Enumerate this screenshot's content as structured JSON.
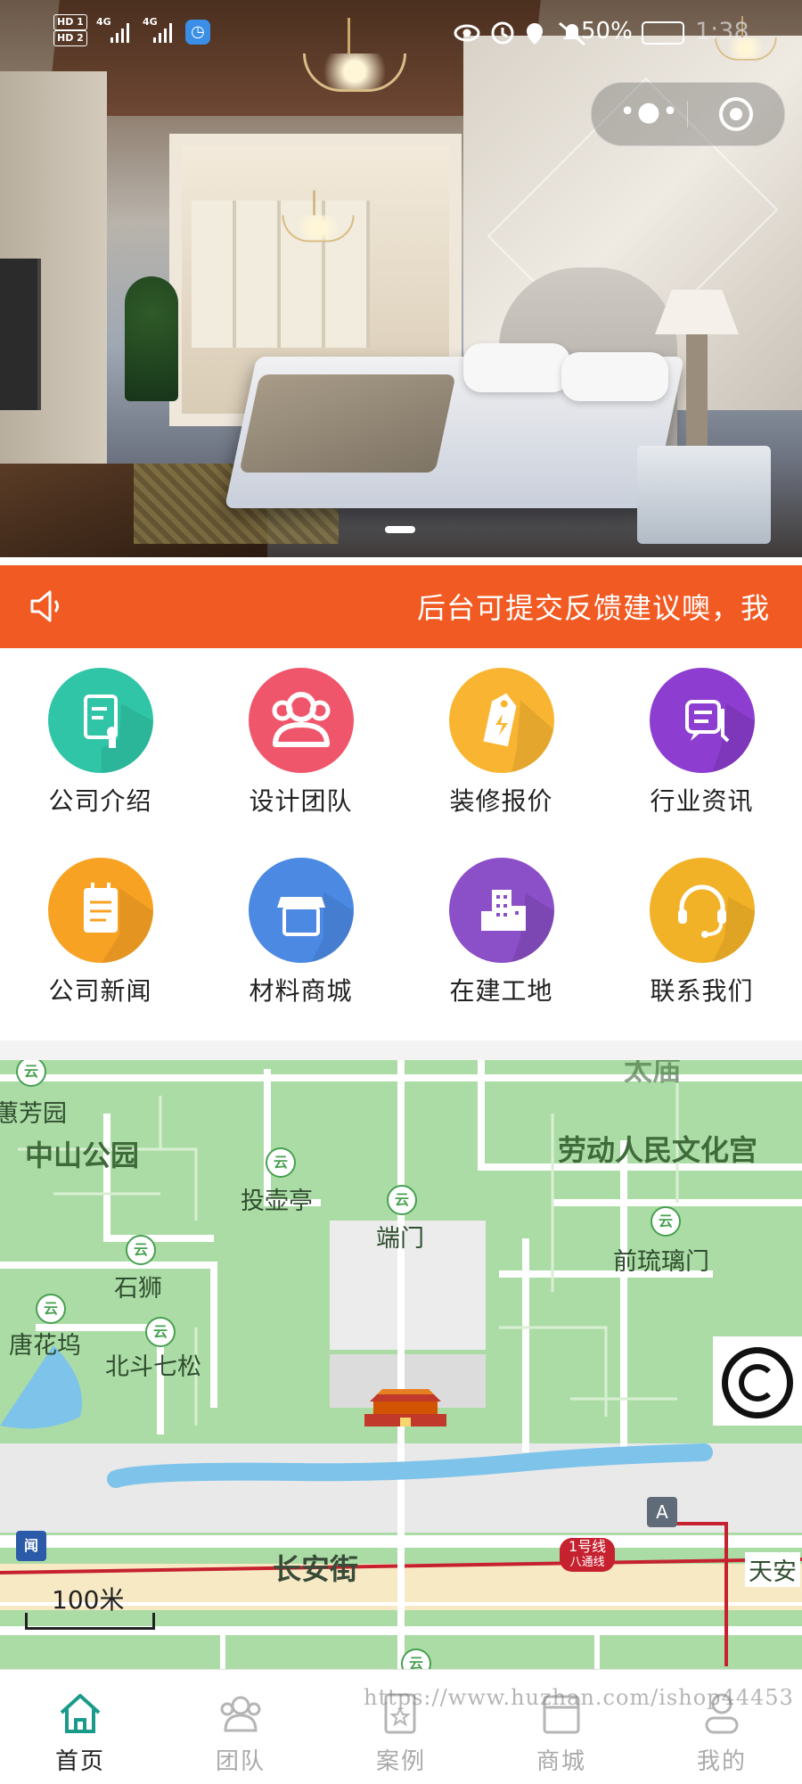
{
  "status_bar": {
    "sim1": "HD 1",
    "sim2": "HD 2",
    "net1": "4G",
    "net2": "4G",
    "battery": "50%",
    "time": "1:38"
  },
  "notice": {
    "text": "后台可提交反馈建议噢，我",
    "icon": "speaker-icon",
    "bg": "#f15a22"
  },
  "menu": [
    {
      "label": "公司介绍",
      "icon": "document-icon",
      "color": "#2fc5a6"
    },
    {
      "label": "设计团队",
      "icon": "team-icon",
      "color": "#f0566b"
    },
    {
      "label": "装修报价",
      "icon": "price-tag-icon",
      "color": "#f9b531"
    },
    {
      "label": "行业资讯",
      "icon": "chat-icon",
      "color": "#8d3ed0"
    },
    {
      "label": "公司新闻",
      "icon": "notepad-icon",
      "color": "#f8a224"
    },
    {
      "label": "材料商城",
      "icon": "shop-icon",
      "color": "#4b89e2"
    },
    {
      "label": "在建工地",
      "icon": "building-icon",
      "color": "#8b4fc8"
    },
    {
      "label": "联系我们",
      "icon": "headset-icon",
      "color": "#f2b227"
    }
  ],
  "map": {
    "labels": {
      "huifang": "蕙芳园",
      "zhongshan": "中山公园",
      "touhu": "投壶亭",
      "duanmen": "端门",
      "laodong": "劳动人民文化宫",
      "qianliuli": "前琉璃门",
      "shishi": "石狮",
      "tanghuawu": "唐花坞",
      "beidou": "北斗七松",
      "changan": "长安街",
      "tianan": "天安",
      "taimiao": "太庙"
    },
    "metro_line1": "1号线",
    "metro_line8": "八通线",
    "line_a": "A",
    "scale": "100米"
  },
  "tabs": [
    {
      "label": "首页",
      "icon": "home-icon",
      "active": true
    },
    {
      "label": "团队",
      "icon": "team-icon",
      "active": false
    },
    {
      "label": "案例",
      "icon": "case-icon",
      "active": false
    },
    {
      "label": "商城",
      "icon": "shop-icon",
      "active": false
    },
    {
      "label": "我的",
      "icon": "user-icon",
      "active": false
    }
  ],
  "watermark": "https://www.huzhan.com/ishop44453",
  "colors": {
    "accent": "#1a9a8a",
    "notice": "#f15a22"
  }
}
